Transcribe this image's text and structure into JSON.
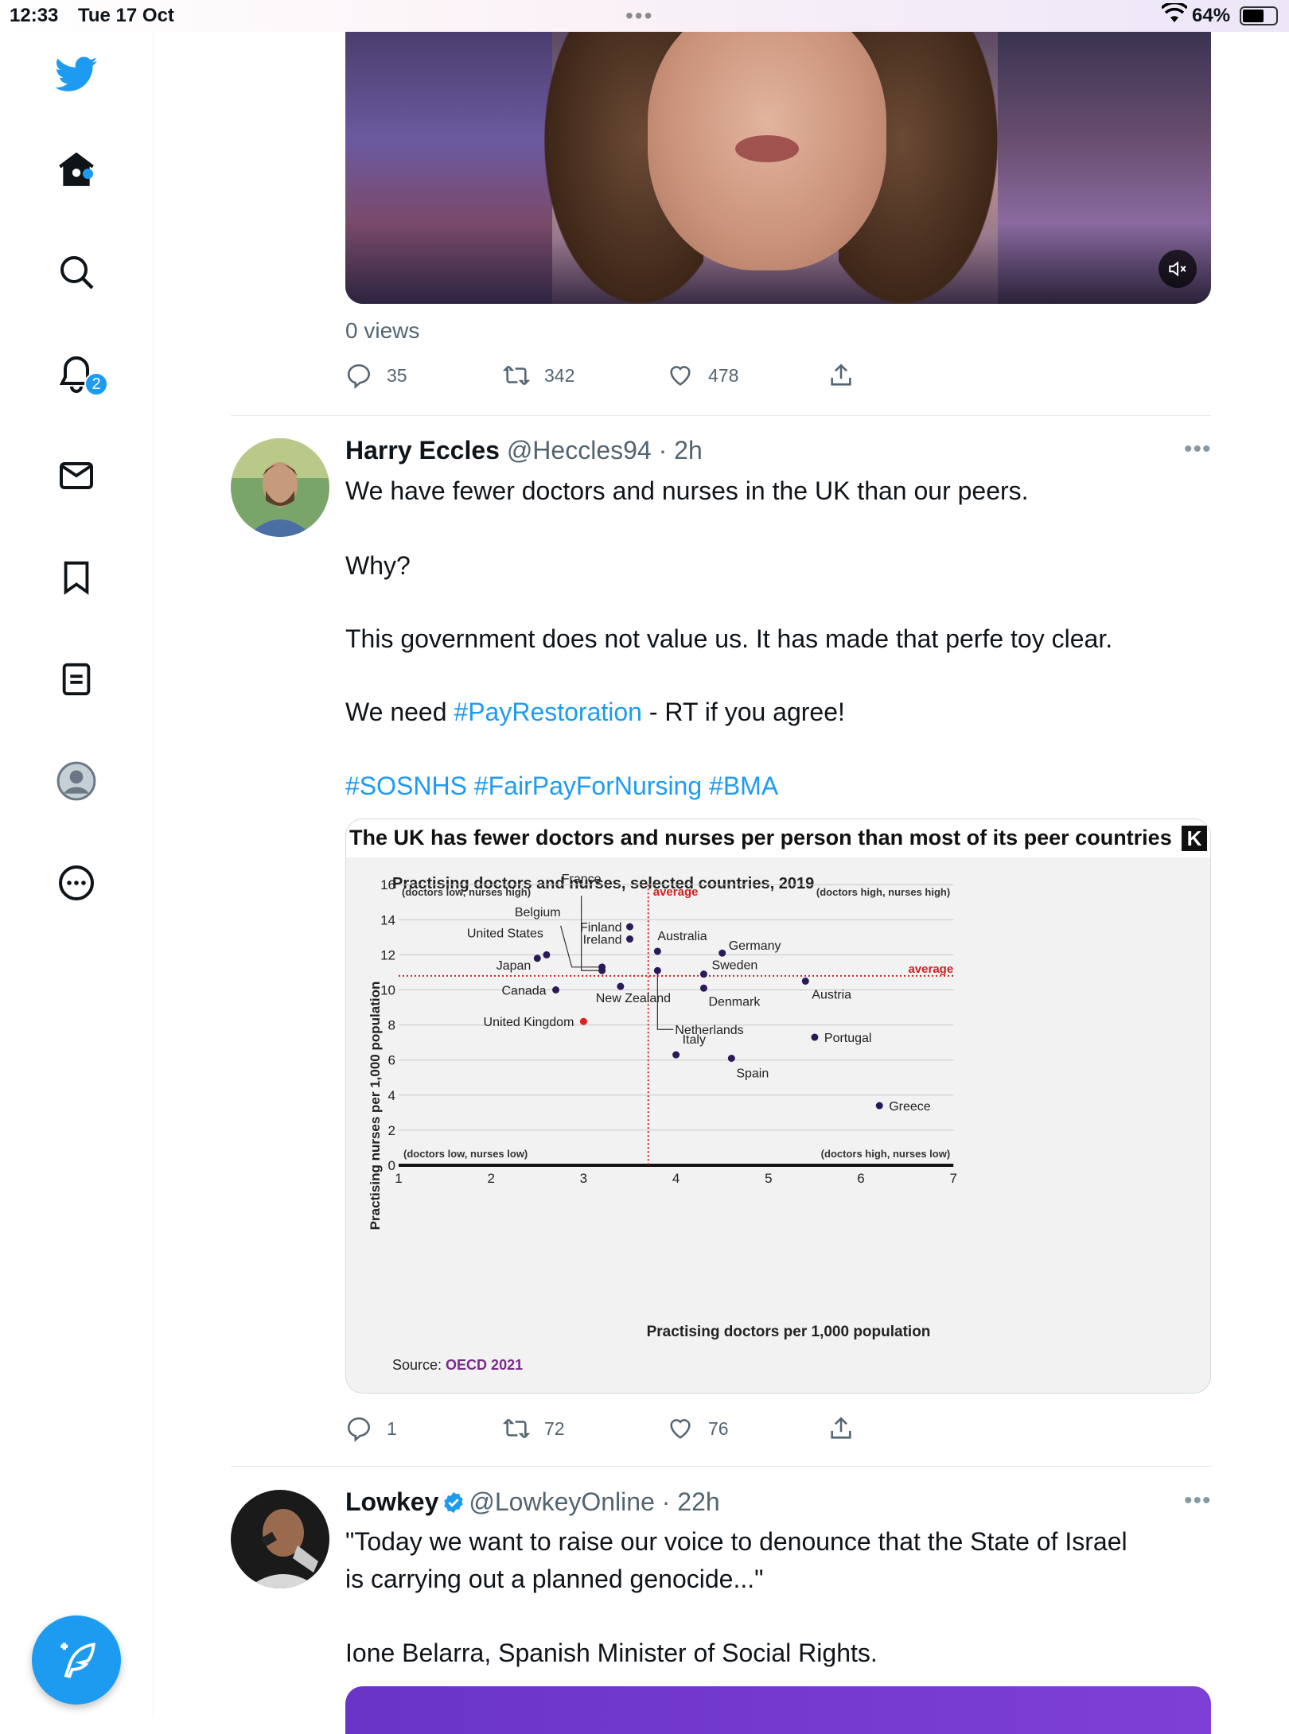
{
  "status_bar": {
    "time": "12:33",
    "date": "Tue 17 Oct",
    "battery": "64%",
    "battery_level": 0.64
  },
  "sidebar": {
    "items": [
      "twitter-logo",
      "home",
      "search",
      "notifications",
      "messages",
      "bookmarks",
      "lists",
      "profile",
      "more"
    ],
    "notification_count": "2"
  },
  "tweet1": {
    "views": "0 views",
    "replies": "35",
    "retweets": "342",
    "likes": "478"
  },
  "tweet2": {
    "name": "Harry Eccles",
    "handle": "@Heccles94",
    "time": "2h",
    "line1": "We have fewer doctors and nurses in the UK than our peers.",
    "line2": "Why?",
    "line3": "This government does not value us. It has made that perfe toy clear.",
    "line4_prefix": "We need ",
    "line4_tag": "#PayRestoration",
    "line4_suffix": " - RT if you agree!",
    "tags": "#SOSNHS #FairPayForNursing #BMA",
    "replies": "1",
    "retweets": "72",
    "likes": "76"
  },
  "tweet3": {
    "name": "Lowkey",
    "handle": "@LowkeyOnline",
    "time": "22h",
    "line1": "\"Today we want to raise our voice to denounce that the State of Israel",
    "line2": "is carrying out a planned genocide...\"",
    "line3": "Ione Belarra, Spanish Minister of Social Rights."
  },
  "chart_data": {
    "type": "scatter",
    "title": "The UK has fewer doctors and nurses per person than most of its peer countries",
    "subtitle": "Practising doctors and nurses, selected countries, 2019",
    "logo": "K",
    "xlabel": "Practising doctors per 1,000 population",
    "ylabel": "Practising nurses per 1,000 population",
    "xlim": [
      1,
      7
    ],
    "ylim": [
      0,
      16
    ],
    "xticks": [
      1,
      2,
      3,
      4,
      5,
      6,
      7
    ],
    "yticks": [
      0,
      2,
      4,
      6,
      8,
      10,
      12,
      14,
      16
    ],
    "grid": true,
    "average_x": 3.7,
    "average_y": 10.8,
    "average_label": "average",
    "quadrant_labels": {
      "top_left": "(doctors low, nurses high)",
      "top_right": "(doctors high, nurses high)",
      "bottom_left": "(doctors low, nurses low)",
      "bottom_right": "(doctors high, nurses low)"
    },
    "source_prefix": "Source: ",
    "source": "OECD 2021",
    "highlight_color": "#e0201c",
    "point_color": "#2b1a5a",
    "points": [
      {
        "name": "Japan",
        "x": 2.5,
        "y": 11.8
      },
      {
        "name": "United States",
        "x": 2.6,
        "y": 12.0
      },
      {
        "name": "Belgium",
        "x": 3.2,
        "y": 11.3
      },
      {
        "name": "France",
        "x": 3.2,
        "y": 11.1
      },
      {
        "name": "Finland",
        "x": 3.5,
        "y": 13.6
      },
      {
        "name": "Ireland",
        "x": 3.5,
        "y": 12.9
      },
      {
        "name": "Canada",
        "x": 2.7,
        "y": 10.0
      },
      {
        "name": "New Zealand",
        "x": 3.4,
        "y": 10.2
      },
      {
        "name": "United Kingdom",
        "x": 3.0,
        "y": 8.2,
        "highlight": true
      },
      {
        "name": "Australia",
        "x": 3.8,
        "y": 12.2
      },
      {
        "name": "Germany",
        "x": 4.5,
        "y": 12.1
      },
      {
        "name": "Netherlands",
        "x": 3.8,
        "y": 11.1
      },
      {
        "name": "Sweden",
        "x": 4.3,
        "y": 10.9
      },
      {
        "name": "Denmark",
        "x": 4.3,
        "y": 10.1
      },
      {
        "name": "Austria",
        "x": 5.4,
        "y": 10.5
      },
      {
        "name": "Portugal",
        "x": 5.5,
        "y": 7.3
      },
      {
        "name": "Italy",
        "x": 4.0,
        "y": 6.3
      },
      {
        "name": "Spain",
        "x": 4.6,
        "y": 6.1
      },
      {
        "name": "Greece",
        "x": 6.2,
        "y": 3.4
      }
    ]
  }
}
